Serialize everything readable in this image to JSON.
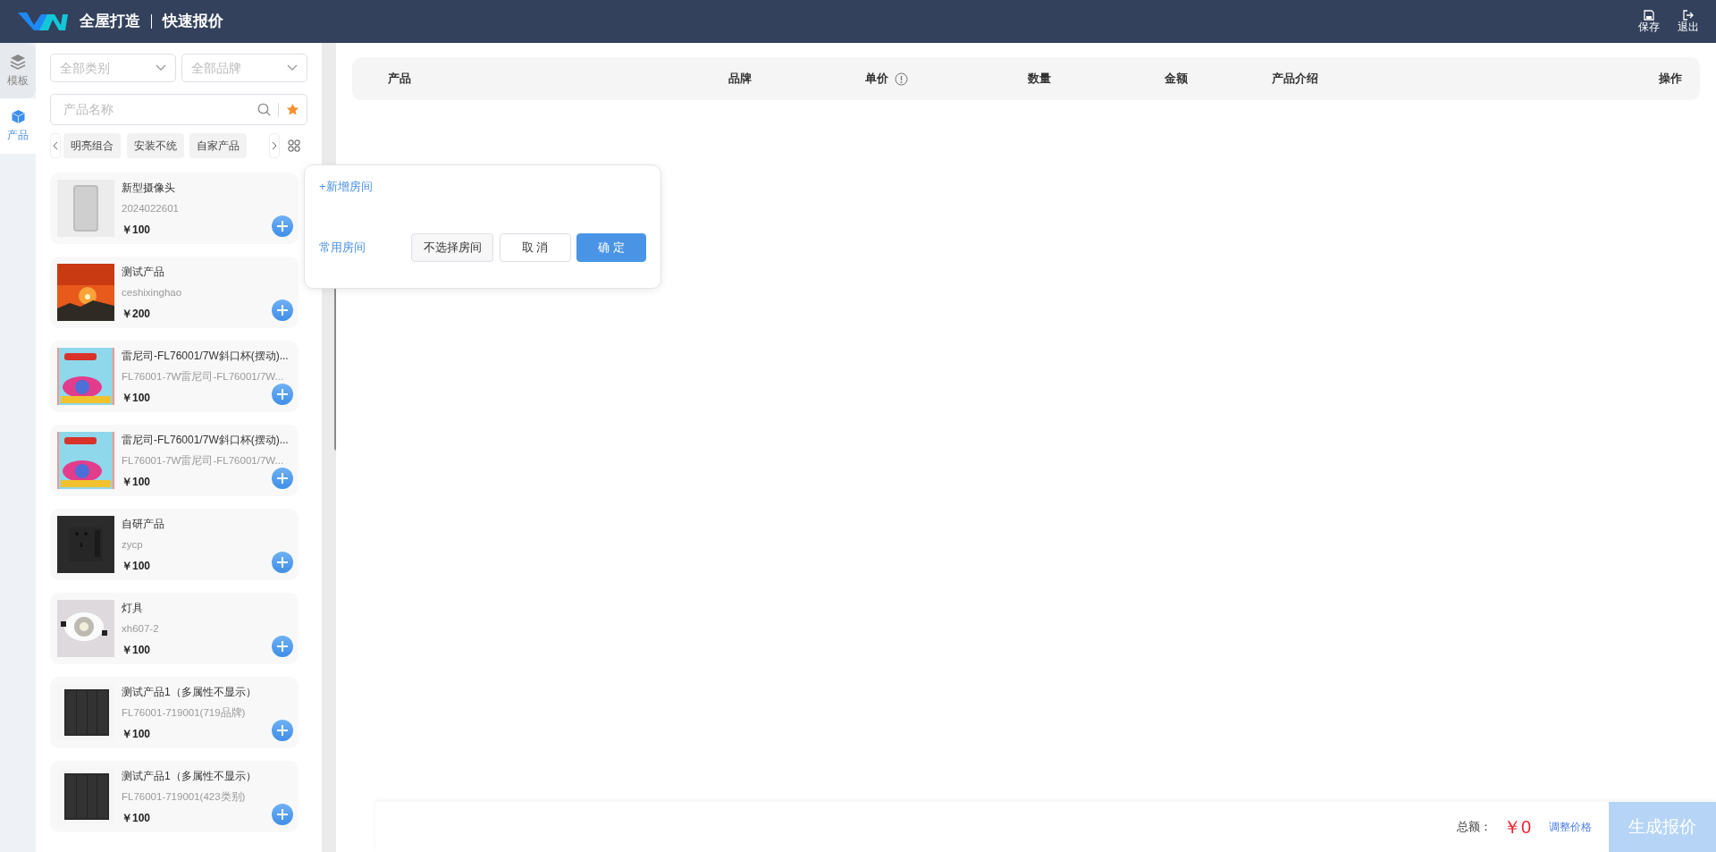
{
  "header": {
    "title": "全屋打造",
    "subtitle": "快速报价",
    "actions": [
      {
        "label": "保存",
        "kind": "save"
      },
      {
        "label": "退出",
        "kind": "exit"
      }
    ]
  },
  "rail": [
    {
      "label": "模板",
      "kind": "layers",
      "selected": false
    },
    {
      "label": "产品",
      "kind": "cube",
      "selected": true
    }
  ],
  "filters": {
    "category": {
      "placeholder": "全部类别"
    },
    "brand": {
      "placeholder": "全部品牌"
    },
    "search": {
      "placeholder": "产品名称"
    }
  },
  "tags": [
    "明亮组合",
    "安装不统",
    "自家产品"
  ],
  "products": [
    {
      "name": "新型摄像头",
      "model": "2024022601",
      "price": "￥100",
      "kind": "picture"
    },
    {
      "name": "测试产品",
      "model": "ceshixinghao",
      "price": "￥200",
      "kind": "picture"
    },
    {
      "name": "雷尼司-FL76001/7W斜口杯(摆动)...",
      "model": "FL76001-7W雷尼司-FL76001/7W...",
      "price": "￥100",
      "kind": "picture"
    },
    {
      "name": "雷尼司-FL76001/7W斜口杯(摆动)...",
      "model": "FL76001-7W雷尼司-FL76001/7W...",
      "price": "￥100",
      "kind": "picture"
    },
    {
      "name": "自研产品",
      "model": "zycp",
      "price": "￥100",
      "kind": "picture"
    },
    {
      "name": "灯具",
      "model": "xh607-2",
      "price": "￥100",
      "kind": "picture"
    },
    {
      "name": "测试产品1（多属性不显示）",
      "model": "FL76001-719001(719品牌)",
      "price": "￥100",
      "kind": "picture"
    },
    {
      "name": "测试产品1（多属性不显示）",
      "model": "FL76001-719001(423类别)",
      "price": "￥100",
      "kind": "picture"
    }
  ],
  "popover": {
    "add_room": "+新增房间",
    "common_rooms": "常用房间",
    "buttons": [
      {
        "label": "不选择房间",
        "kind": "plain"
      },
      {
        "label": "取 消",
        "kind": "outline"
      },
      {
        "label": "确 定",
        "kind": "primary"
      }
    ]
  },
  "table": {
    "columns": [
      {
        "label": "产品",
        "kind": "text"
      },
      {
        "label": "品牌",
        "kind": "text"
      },
      {
        "label": "单价",
        "kind": "info"
      },
      {
        "label": "数量",
        "kind": "text"
      },
      {
        "label": "金额",
        "kind": "text"
      },
      {
        "label": "产品介绍",
        "kind": "text"
      },
      {
        "label": "操作",
        "kind": "text"
      }
    ]
  },
  "footer": {
    "total_label": "总额：",
    "total": "￥0",
    "adjust": "调整价格",
    "generate": "生成报价",
    "generate_disabled": true
  }
}
